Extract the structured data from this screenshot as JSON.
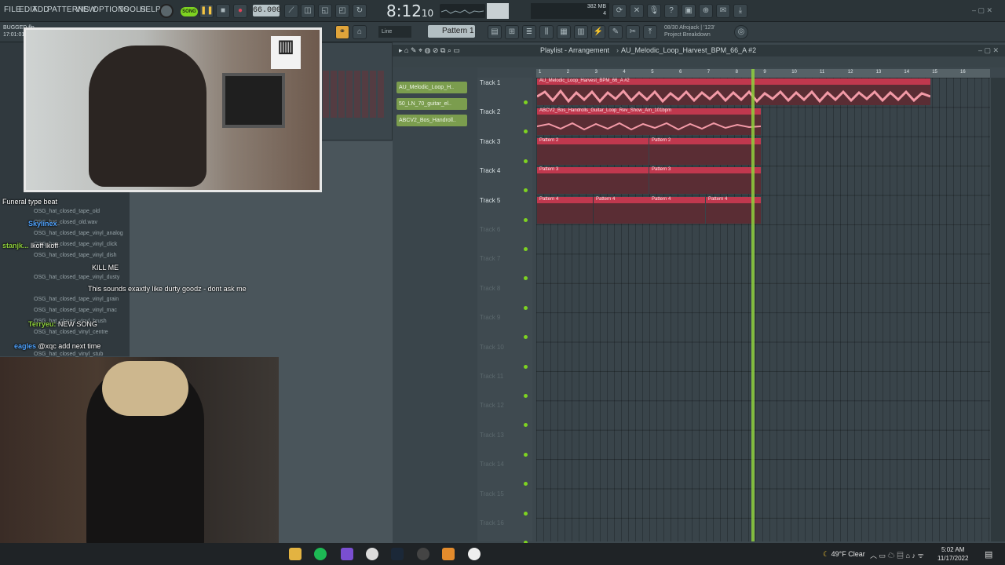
{
  "menu": [
    "FILE",
    "EDIT",
    "ADD",
    "PATTERNS",
    "VIEW",
    "OPTIONS",
    "TOOLS",
    "HELP"
  ],
  "toolbar": {
    "song_label": "SONG",
    "bpm": "66.000",
    "time_main": "8:12",
    "time_sub": "10",
    "cpu": "382 MB",
    "cpu2": "4",
    "pattern": "Pattern 1",
    "snap": "Line",
    "hint_line1": "08/30 Afrojack | '123'",
    "hint_line2": "Project Breakdown"
  },
  "project": {
    "name": "BUGGED.flp",
    "timestamp": "17:01:01"
  },
  "browser_items": [
    "OSG_hat_closed_tape_old",
    "OSG_hat_closed_old.wav",
    "OSG_hat_closed_tape_vinyl_analog",
    "OSG_hat_closed_tape_vinyl_click",
    "OSG_hat_closed_tape_vinyl_dish",
    "OSG_hat_closed_tape_vinyl_dusty",
    "OSG_hat_closed_tape_vinyl_grain",
    "OSG_hat_closed_tape_vinyl_mac",
    "OSG_hat_closed_vinyl_brush",
    "OSG_hat_closed_vinyl_centre",
    "OSG_hat_closed_vinyl_stub"
  ],
  "playlist": {
    "title": "Playlist - Arrangement",
    "arrangement": "AU_Melodic_Loop_Harvest_BPM_66_A #2",
    "patterns": [
      "AU_Melodic_Loop_H..",
      "50_LN_70_guitar_el..",
      "ABCV2_Bos_Handroll.."
    ],
    "ruler": [
      "1",
      "2",
      "3",
      "4",
      "5",
      "6",
      "7",
      "8",
      "9",
      "10",
      "11",
      "12",
      "13",
      "14",
      "15",
      "16"
    ],
    "tracks": [
      "Track 1",
      "Track 2",
      "Track 3",
      "Track 4",
      "Track 5",
      "Track 6",
      "Track 7",
      "Track 8",
      "Track 9",
      "Track 10",
      "Track 11",
      "Track 12",
      "Track 13",
      "Track 14",
      "Track 15",
      "Track 16"
    ],
    "clips": {
      "t1": "AU_Melodic_Loop_Harvest_BPM_66_A #2",
      "t2": "ABCV2_Bos_Handrolls_Guitar_Loop_Rev_Show_Am_101bpm",
      "t3a": "Pattern 2",
      "t3b": "Pattern 2",
      "t4a": "Pattern 3",
      "t4b": "Pattern 3",
      "t5a": "Pattern 4",
      "t5b": "Pattern 4",
      "t5c": "Pattern 4",
      "t5d": "Pattern 4"
    }
  },
  "chat": [
    {
      "name": "",
      "text": "Funeral type beat",
      "color": "#ffffff"
    },
    {
      "name": "Skylinex",
      "text": "",
      "color": "#4fa3ff"
    },
    {
      "name": "stanjk...",
      "text": "lkoff lkoff",
      "color": "#8fd13d"
    },
    {
      "name": "",
      "text": "KILL ME",
      "color": "#ffffff"
    },
    {
      "name": "",
      "text": "This sounds exaxtly like durty goodz - dont ask me",
      "color": "#ffffff"
    },
    {
      "name": "Terryeu:",
      "text": "NEW SONG",
      "color": "#8fd13d"
    },
    {
      "name": "eagles",
      "text": "@xqc add next time",
      "color": "#4fa3ff"
    }
  ],
  "taskbar": {
    "weather": "49°F  Clear",
    "time": "5:02 AM",
    "date": "11/17/2022"
  },
  "colors": {
    "clip_red": "#c0384e",
    "clip_body": "#5a2d34",
    "playhead": "#8fd13d",
    "pattern_green": "#7b9d4e",
    "song_green": "#7ed321"
  }
}
